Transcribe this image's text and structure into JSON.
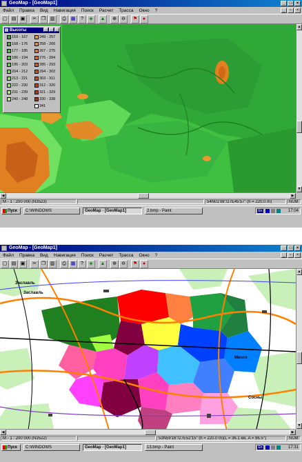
{
  "colors": {
    "titlebar": "#000080",
    "map_green": "#40c040",
    "map_orange": "#e08020",
    "map_dark_green": "#208020"
  },
  "window": {
    "title": "GeoMap - [GeoMap1]",
    "menu": [
      "Файл",
      "Правка",
      "Вид",
      "Навигация",
      "Поиск",
      "Расчет",
      "Трасса",
      "Окно",
      "?"
    ]
  },
  "legend": {
    "title": "Высоты",
    "left_column": [
      {
        "label": "159 - 167",
        "color": "#40a040"
      },
      {
        "label": "168 - 176",
        "color": "#40b040"
      },
      {
        "label": "177 - 185",
        "color": "#40c040"
      },
      {
        "label": "186 - 194",
        "color": "#50c848"
      },
      {
        "label": "195 - 203",
        "color": "#60d050"
      },
      {
        "label": "204 - 212",
        "color": "#70d858"
      },
      {
        "label": "213 - 221",
        "color": "#80e060"
      },
      {
        "label": "222 - 230",
        "color": "#90e868"
      },
      {
        "label": "231 - 239",
        "color": "#a0f070"
      },
      {
        "label": "240 - 248",
        "color": "#b0f078"
      }
    ],
    "right_column": [
      {
        "label": "249 - 257",
        "color": "#f0a030"
      },
      {
        "label": "258 - 266",
        "color": "#e89028"
      },
      {
        "label": "267 - 275",
        "color": "#e08020"
      },
      {
        "label": "276 - 284",
        "color": "#d87020"
      },
      {
        "label": "285 - 293",
        "color": "#d06020"
      },
      {
        "label": "294 - 302",
        "color": "#c85818"
      },
      {
        "label": "303 - 311",
        "color": "#c05018"
      },
      {
        "label": "312 - 320",
        "color": "#b84810"
      },
      {
        "label": "321 - 329",
        "color": "#b04010"
      },
      {
        "label": "330 - 338",
        "color": "#a83808"
      },
      {
        "label": "341",
        "color": "#ffffff"
      }
    ]
  },
  "screen1": {
    "status": {
      "scale": "M - 1 : 200 000 (N3523)",
      "coords": "54N01'08\"/27E45'57\" (h = 220.0 m)",
      "num": "NUM"
    },
    "taskbar": {
      "start": "Пуск",
      "tasks": [
        "C:\\WINDOWS",
        "GeoMap - [GeoMap1]",
        "2.bmp - Paint"
      ],
      "lang": "En",
      "clock": "17:04"
    }
  },
  "screen2": {
    "map_labels": [
      "Заславль",
      "Заславль",
      "Минск",
      "Сосны"
    ],
    "status": {
      "scale": "M - 1 : 200 000 (N3522)",
      "coords": "53N59'16\"/27E52'15\" (h = 220.0 m)(L = 36.1 км, A = 96.5°)",
      "num": "NUM"
    },
    "taskbar": {
      "start": "Пуск",
      "tasks": [
        "C:\\WINDOWS",
        "GeoMap - [GeoMap1]",
        "13.bmp - Paint"
      ],
      "lang": "En",
      "clock": "17:31"
    }
  }
}
